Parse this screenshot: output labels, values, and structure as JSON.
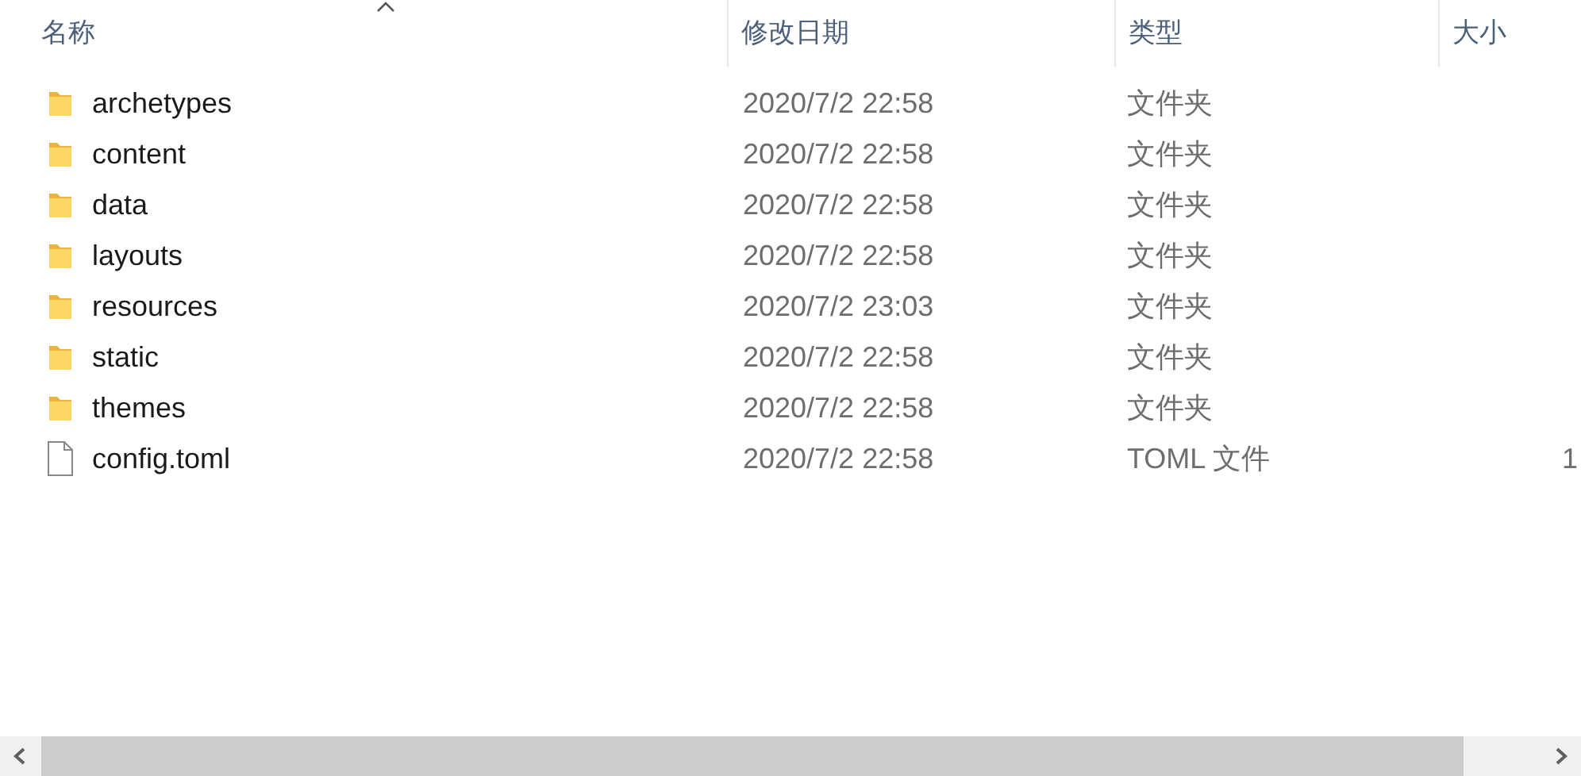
{
  "columns": [
    {
      "label": "名称",
      "sorted": true
    },
    {
      "label": "修改日期",
      "sorted": false
    },
    {
      "label": "类型",
      "sorted": false
    },
    {
      "label": "大小",
      "sorted": false
    }
  ],
  "rows": [
    {
      "kind": "folder",
      "name": "archetypes",
      "date": "2020/7/2 22:58",
      "type": "文件夹"
    },
    {
      "kind": "folder",
      "name": "content",
      "date": "2020/7/2 22:58",
      "type": "文件夹"
    },
    {
      "kind": "folder",
      "name": "data",
      "date": "2020/7/2 22:58",
      "type": "文件夹"
    },
    {
      "kind": "folder",
      "name": "layouts",
      "date": "2020/7/2 22:58",
      "type": "文件夹"
    },
    {
      "kind": "folder",
      "name": "resources",
      "date": "2020/7/2 23:03",
      "type": "文件夹"
    },
    {
      "kind": "folder",
      "name": "static",
      "date": "2020/7/2 22:58",
      "type": "文件夹"
    },
    {
      "kind": "folder",
      "name": "themes",
      "date": "2020/7/2 22:58",
      "type": "文件夹"
    },
    {
      "kind": "file",
      "name": "config.toml",
      "date": "2020/7/2 22:58",
      "type": "TOML 文件",
      "size": "1"
    }
  ]
}
